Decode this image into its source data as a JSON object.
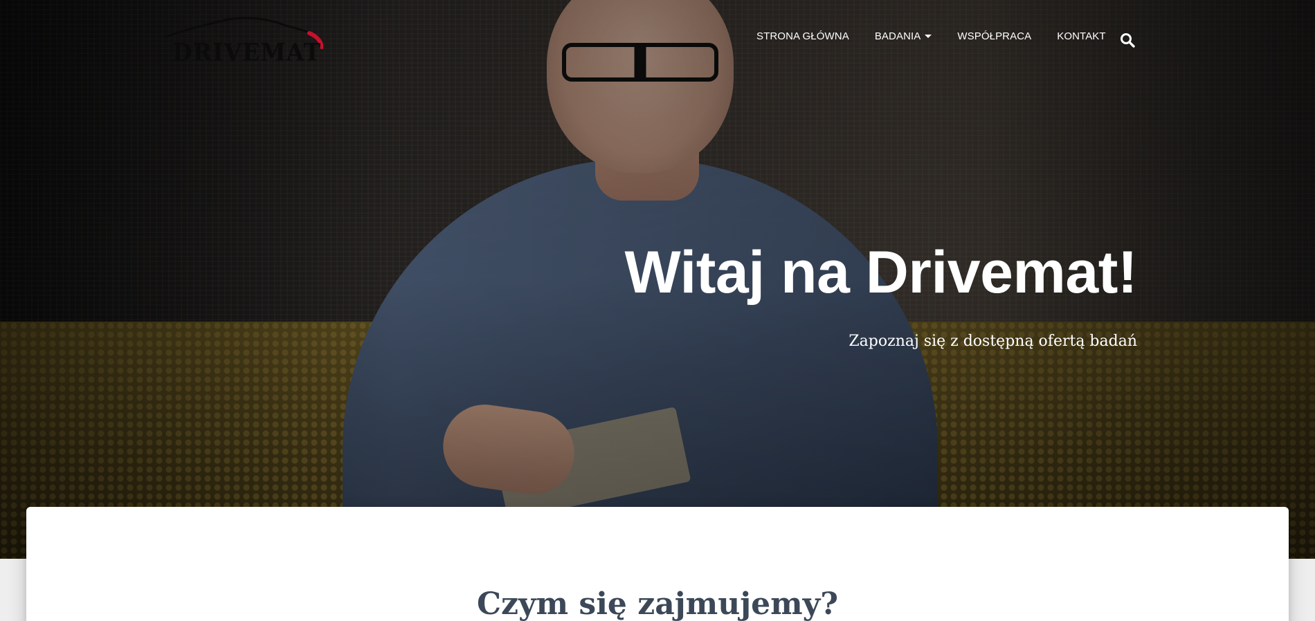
{
  "header": {
    "logo_text": "DRIVEMAT",
    "nav_items": [
      {
        "label": "STRONA GŁÓWNA"
      },
      {
        "label": "BADANIA",
        "has_dropdown": true
      },
      {
        "label": "WSPÓŁPRACA"
      },
      {
        "label": "KONTAKT"
      }
    ],
    "search_icon": "search-icon"
  },
  "hero": {
    "title": "Witaj na Drivemat!",
    "subtitle": "Zapoznaj się z dostępną ofertą badań",
    "background": "photo-man-with-glasses-writing-in-notebook"
  },
  "main": {
    "section_title": "Czym się zajmujemy?"
  },
  "colors": {
    "nav_text": "#ffffff",
    "section_title": "#3c4858",
    "logo_accent": "#c8102e",
    "page_bg": "#eeeeee"
  }
}
